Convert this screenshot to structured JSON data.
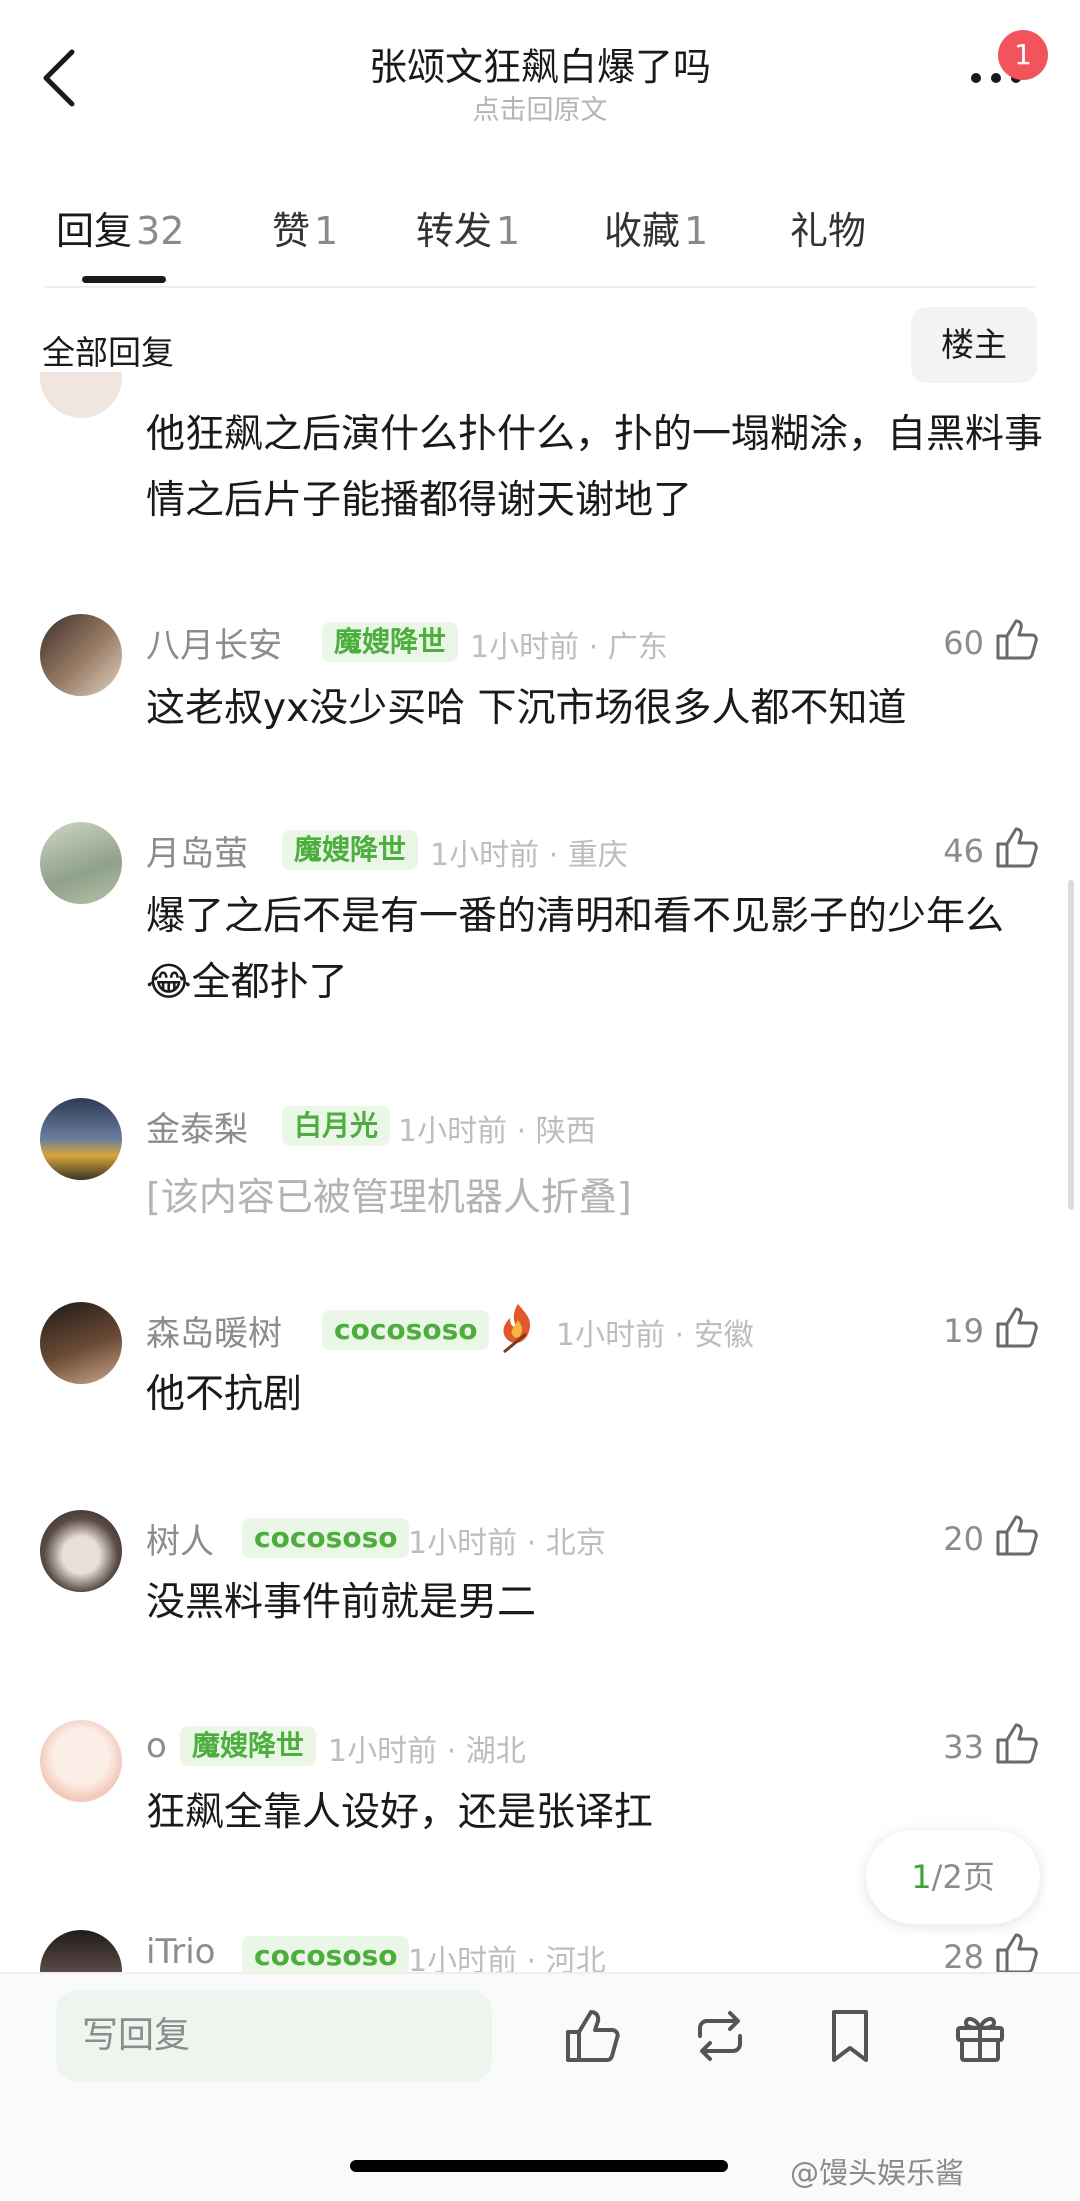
{
  "header": {
    "title": "张颂文狂飙白爆了吗",
    "subtitle": "点击回原文",
    "notification_count": "1"
  },
  "tabs": [
    {
      "label": "回复",
      "count": "32",
      "active": true
    },
    {
      "label": "赞",
      "count": "1"
    },
    {
      "label": "转发",
      "count": "1"
    },
    {
      "label": "收藏",
      "count": "1"
    },
    {
      "label": "礼物",
      "count": ""
    }
  ],
  "section": {
    "title": "全部回复",
    "owner_button": "楼主"
  },
  "comments": [
    {
      "text": "他狂飙之后演什么扑什么，扑的一塌糊涂，自黑料事情之后片子能播都得谢天谢地了"
    },
    {
      "user": "八月长安",
      "badge": "魔嫂降世",
      "meta": "1小时前 · 广东",
      "likes": "60",
      "text": "这老叔yx没少买哈 下沉市场很多人都不知道"
    },
    {
      "user": "月岛萤",
      "badge": "魔嫂降世",
      "meta": "1小时前 · 重庆",
      "likes": "46",
      "text": "爆了之后不是有一番的清明和看不见影子的少年么😂全都扑了"
    },
    {
      "user": "金泰梨",
      "badge": "白月光",
      "meta": "1小时前 · 陕西",
      "text": "[该内容已被管理机器人折叠]"
    },
    {
      "user": "森岛暖树",
      "badge": "cocososo",
      "meta": "1小时前 · 安徽",
      "likes": "19",
      "text": "他不抗剧"
    },
    {
      "user": "树人",
      "badge": "cocososo",
      "meta": "1小时前 · 北京",
      "likes": "20",
      "text": "没黑料事件前就是男二"
    },
    {
      "user": "o",
      "badge": "魔嫂降世",
      "meta": "1小时前 · 湖北",
      "likes": "33",
      "text": "狂飙全靠人设好，还是张译扛"
    },
    {
      "user": "iTrio",
      "badge": "cocososo",
      "meta": "1小时前 · 河北",
      "likes": "28"
    }
  ],
  "pager": {
    "current": "1",
    "total": "/2页"
  },
  "bottom": {
    "reply_placeholder": "写回复"
  },
  "watermark": "@馒头娱乐酱",
  "colors": {
    "badge_green": "#4cae3c",
    "badge_bg": "#eaf7e6",
    "notification_red": "#f2545b"
  }
}
